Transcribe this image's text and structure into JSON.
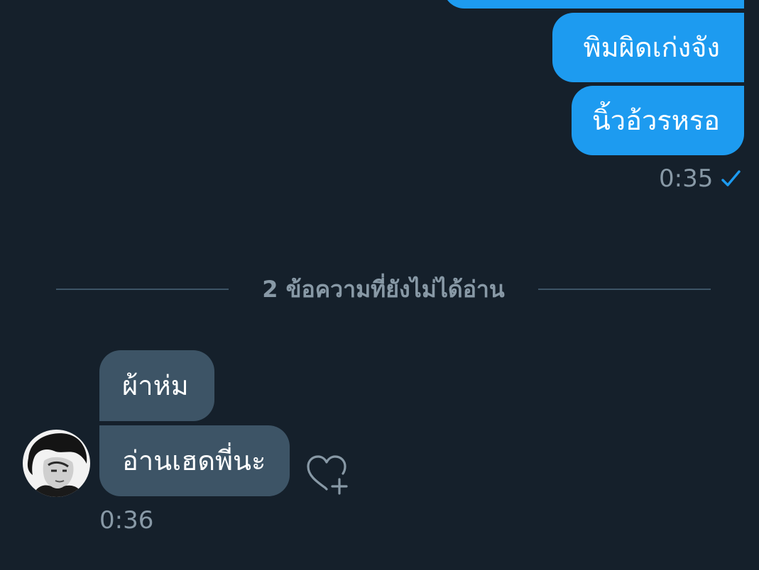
{
  "conversation": {
    "outgoing": [
      {
        "text": ""
      },
      {
        "text": "พิมผิดเก่งจัง"
      },
      {
        "text": "นิ้วอ้วรหรอ"
      }
    ],
    "outgoing_time": "0:35",
    "divider": "2 ข้อความที่ยังไม่ได้อ่าน",
    "incoming": [
      {
        "text": "ผ้าห่ม"
      },
      {
        "text": "อ่านเฮดพี่นะ"
      }
    ],
    "incoming_time": "0:36"
  },
  "colors": {
    "background": "#15202b",
    "outgoing_bubble": "#1d9bf0",
    "incoming_bubble": "#3d5466",
    "meta_text": "#8899a6",
    "check": "#1d9bf0"
  },
  "icons": {
    "sent": "check-icon",
    "react": "heart-add-icon",
    "avatar": "user-avatar"
  }
}
